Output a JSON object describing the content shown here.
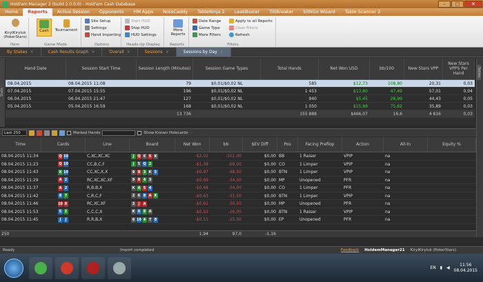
{
  "window": {
    "title": "Hold'em Manager 2 (build 2.0.0.0) - Hold'em Cash Database"
  },
  "menu": [
    "Home",
    "Reports",
    "Active Session",
    "Opponents",
    "HM Apps",
    "NoteCaddy",
    "TableNinja 2",
    "LeakBuster",
    "TiltBreaker",
    "SitNGo Wizard",
    "Table Scanner 2"
  ],
  "ribbon": {
    "hero_label": "KiryIKiryluk (PokerStars)",
    "hero_group": "Hero",
    "cash": "Cash",
    "tournament": "Tournament",
    "game_mode": "Game Mode",
    "site_setup": "Site Setup",
    "settings": "Settings",
    "hand_importing": "Hand Importing",
    "options": "Options",
    "start_hud": "Start HUD",
    "stop_hud": "Stop HUD",
    "hud_settings": "HUD Settings",
    "hud_group": "Heads-Up Display",
    "more_reports": "More Reports",
    "reports_group": "Reports",
    "date_range": "Date Range",
    "game_type": "Game Type",
    "more_filters": "More Filters",
    "apply_all": "Apply to all Reports",
    "clear_filters": "Clear Filters",
    "refresh": "Refresh",
    "filters_group": "Filters"
  },
  "tabs": [
    "By Stakes",
    "Cash Results Graph",
    "Overall",
    "Sessions",
    "Sessions by Day"
  ],
  "side_left": "Stats",
  "side_right": "Tables",
  "sessions": {
    "headers": [
      "Hand Date",
      "Session Start Time",
      "Session Length (Minutes)",
      "Session Game Types",
      "Total Hands",
      "Net Won USD",
      "bb/100",
      "New Stars VPP",
      "New Stars VPPS Per Hand"
    ],
    "rows": [
      [
        "08.04.2015",
        "08.04.2015 11:08",
        "79",
        "$0,01/$0,02 NL",
        "585",
        "$12,73",
        "108,80",
        "20,31",
        "0,03"
      ],
      [
        "07.04.2015",
        "07.04.2015 15:55",
        "196",
        "$0,01/$0,02 NL",
        "1 453",
        "$13,80",
        "47,49",
        "57,01",
        "0,04"
      ],
      [
        "06.04.2015",
        "06.04.2015 21:47",
        "127",
        "$0,01/$0,02 NL",
        "940",
        "$5,45",
        "28,99",
        "44,43",
        "0,05"
      ],
      [
        "05.04.2015",
        "05.04.2015 16:59",
        "168",
        "$0,01/$0,02 NL",
        "1 050",
        "$15,88",
        "75,62",
        "35,89",
        "0,03"
      ]
    ],
    "total": [
      "",
      "",
      "13 736",
      "",
      "155 888",
      "$466,07",
      "16,6",
      "4 816",
      "0,03"
    ]
  },
  "toolbar": {
    "last": "Last 250",
    "marked": "Marked Hands",
    "show_known": "Show Known Holecards"
  },
  "hands": {
    "headers": [
      "Time",
      "Cards",
      "Line",
      "Board",
      "Net Won",
      "bb",
      "$EV Diff",
      "Pos",
      "Facing Preflop",
      "Action",
      "All-In",
      "Equity %"
    ],
    "rows": [
      {
        "time": "08.04.2015 11:34",
        "cards": [
          [
            "Q",
            "#b03030"
          ],
          [
            "10",
            "#2a6ab0"
          ]
        ],
        "line": "C,XC,XC,XC",
        "board": [
          [
            "J",
            "#2a8a3a"
          ],
          [
            "Q",
            "#b03030"
          ],
          [
            "6",
            "#555"
          ],
          [
            "5",
            "#b03030"
          ],
          [
            "K",
            "#555"
          ]
        ],
        "net": "-$2,02",
        "bb": "-101,00",
        "ev": "$0,00",
        "pos": "BB",
        "facing": "1 Raiser",
        "action": "VPIP",
        "allin": "na"
      },
      {
        "time": "08.04.2015 11:23",
        "cards": [
          [
            "Q",
            "#b03030"
          ],
          [
            "10",
            "#2a6ab0"
          ]
        ],
        "line": "CC,B,C,F",
        "board": [
          [
            "J",
            "#2a8a3a"
          ],
          [
            "5",
            "#555"
          ],
          [
            "Q",
            "#2a6ab0"
          ],
          [
            "2",
            "#2a8a3a"
          ],
          [
            "",
            ""
          ]
        ],
        "net": "-$1,38",
        "bb": "-69,00",
        "ev": "$0,00",
        "pos": "CO",
        "facing": "1 Limper",
        "action": "VPIP",
        "allin": "na"
      },
      {
        "time": "08.04.2015 11:43",
        "cards": [
          [
            "K",
            "#2a8a3a"
          ],
          [
            "10",
            "#2a6ab0"
          ]
        ],
        "line": "CC,XC,X,X",
        "board": [
          [
            "9",
            "#555"
          ],
          [
            "8",
            "#b03030"
          ],
          [
            "3",
            "#2a8a3a"
          ],
          [
            "K",
            "#555"
          ],
          [
            "5",
            "#2a6ab0"
          ]
        ],
        "net": "-$0,97",
        "bb": "-48,50",
        "ev": "$0,00",
        "pos": "BTN",
        "facing": "1 Limper",
        "action": "VPIP",
        "allin": "na"
      },
      {
        "time": "08.04.2015 11:29",
        "cards": [
          [
            "A",
            "#b03030"
          ],
          [
            "2",
            "#2a6ab0"
          ]
        ],
        "line": "RC,XC,XC,XF",
        "board": [
          [
            "9",
            "#555"
          ],
          [
            "8",
            "#b03030"
          ],
          [
            "4",
            "#2a8a3a"
          ],
          [
            "3",
            "#555"
          ],
          [
            "",
            ""
          ]
        ],
        "net": "-$0,69",
        "bb": "-34,50",
        "ev": "$0,00",
        "pos": "MP",
        "facing": "Unopened",
        "action": "PFR",
        "allin": "na"
      },
      {
        "time": "08.04.2015 11:37",
        "cards": [
          [
            "A",
            "#b03030"
          ],
          [
            "2",
            "#2a6ab0"
          ]
        ],
        "line": "R,B,B,X",
        "board": [
          [
            "K",
            "#555"
          ],
          [
            "A",
            "#2a8a3a"
          ],
          [
            "5",
            "#b03030"
          ],
          [
            "4",
            "#2a6ab0"
          ],
          [
            "",
            ""
          ]
        ],
        "net": "-$0,68",
        "bb": "-34,00",
        "ev": "$0,00",
        "pos": "CO",
        "facing": "1 Limper",
        "action": "PFR",
        "allin": "na"
      },
      {
        "time": "08.04.2015 11:42",
        "cards": [
          [
            "8",
            "#2a6ab0"
          ],
          [
            "7",
            "#2a8a3a"
          ]
        ],
        "line": "C,R,C,F",
        "board": [
          [
            "2",
            "#555"
          ],
          [
            "6",
            "#555"
          ],
          [
            "8",
            "#2a6ab0"
          ],
          [
            "A",
            "#b03030"
          ],
          [
            "K",
            "#2a8a3a"
          ]
        ],
        "net": "-$0,63",
        "bb": "-31,50",
        "ev": "$0,00",
        "pos": "BTN",
        "facing": "1 Limper",
        "action": "VPIP",
        "allin": "na"
      },
      {
        "time": "08.04.2015 11:46",
        "cards": [
          [
            "10",
            "#b03030"
          ],
          [
            "8",
            "#b03030"
          ]
        ],
        "line": "RC,XC,XF",
        "board": [
          [
            "3",
            "#555"
          ],
          [
            "J",
            "#b03030"
          ],
          [
            "A",
            "#b03030"
          ],
          [
            "",
            ""
          ],
          [
            "",
            ""
          ]
        ],
        "net": "-$0,61",
        "bb": "-30,50",
        "ev": "$0,00",
        "pos": "MP",
        "facing": "Unopened",
        "action": "PFR",
        "allin": "na"
      },
      {
        "time": "08.04.2015 11:53",
        "cards": [
          [
            "5",
            "#2a6ab0"
          ],
          [
            "2",
            "#2a8a3a"
          ]
        ],
        "line": "C,C,C,X",
        "board": [
          [
            "K",
            "#555"
          ],
          [
            "6",
            "#2a6ab0"
          ],
          [
            "8",
            "#2a8a3a"
          ],
          [
            "A",
            "#555"
          ],
          [
            "",
            ""
          ]
        ],
        "net": "-$0,52",
        "bb": "-26,00",
        "ev": "$0,00",
        "pos": "BTN",
        "facing": "1 Raiser",
        "action": "VPIP",
        "allin": "na"
      },
      {
        "time": "08.04.2015 11:45",
        "cards": [
          [
            "J",
            "#2a6ab0"
          ],
          [
            "J",
            "#2a6ab0"
          ]
        ],
        "line": "R,R,B,X",
        "board": [
          [
            "6",
            "#555"
          ],
          [
            "10",
            "#2a6ab0"
          ],
          [
            "4",
            "#2a8a3a"
          ],
          [
            "7",
            "#555"
          ],
          [
            "8",
            "#2a6ab0"
          ]
        ],
        "net": "-$0,51",
        "bb": "-25,50",
        "ev": "$0,00",
        "pos": "EP",
        "facing": "Unopened",
        "action": "PFR",
        "allin": "na"
      }
    ],
    "footer": [
      "250",
      "",
      "",
      "",
      "1,94",
      "97,0",
      "-1,16"
    ]
  },
  "status": {
    "ready": "Ready",
    "import": "Import completed",
    "feedback": "Feedback",
    "hm": "HoldemManager21",
    "player": "KiryIKiryluk (PokerStars)"
  },
  "tray": {
    "lang": "EN",
    "time": "11:56",
    "date": "08.04.2015"
  }
}
